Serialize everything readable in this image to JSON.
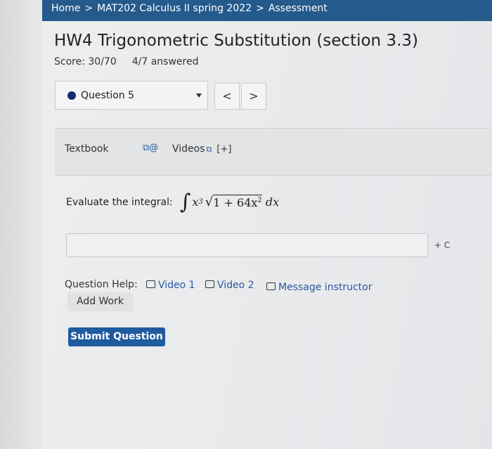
{
  "breadcrumb": {
    "home": "Home",
    "course": "MAT202 Calculus II spring 2022",
    "current": "Assessment",
    "separator": ">"
  },
  "assessment": {
    "title": "HW4 Trigonometric Substitution (section 3.3)",
    "score": "Score: 30/70",
    "answered": "4/7 answered"
  },
  "question_selector": {
    "selected": "Question 5"
  },
  "nav": {
    "prev": "<",
    "next": ">"
  },
  "resources": {
    "textbook": "Textbook",
    "videos": "Videos",
    "expand": "[+]"
  },
  "question": {
    "prompt": "Evaluate the integral:",
    "integral": {
      "power": "3",
      "inner_power": "2",
      "radicand_start": "1 + 64x",
      "dx": "dx"
    }
  },
  "answer": {
    "value": "",
    "suffix": "+ C"
  },
  "help": {
    "label": "Question Help:",
    "video1": "Video 1",
    "video2": "Video 2",
    "message": "Message instructor",
    "add_work": "Add Work"
  },
  "submit_label": "Submit Question",
  "colors": {
    "topbar": "#245a8c",
    "accent": "#1f5b9f",
    "link": "#2c5aa0"
  }
}
